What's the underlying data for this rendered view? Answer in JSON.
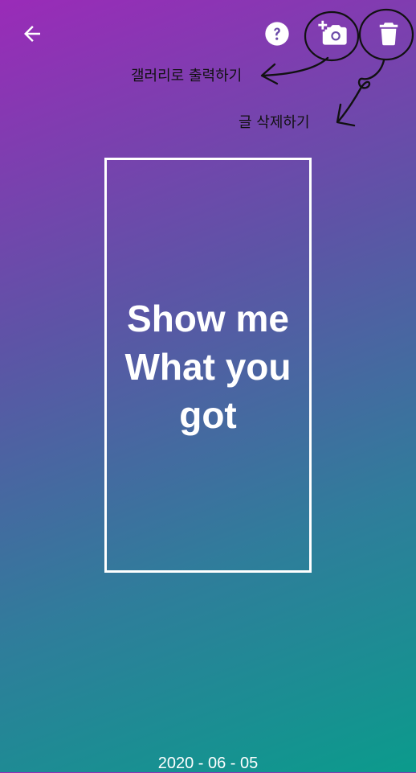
{
  "toolbar": {
    "back_icon": "arrow-left-icon",
    "help_icon": "question-circle-icon",
    "save_icon": "add-photo-camera-icon",
    "delete_icon": "trash-icon"
  },
  "annotations": {
    "save_to_gallery": "갤러리로 출력하기",
    "delete_post": "글 삭제하기"
  },
  "post": {
    "text": "Show me\nWhat you\ngot",
    "date": "2020 - 06 - 05"
  },
  "colors": {
    "gradient_top": "#9a2bb8",
    "gradient_bottom": "#0b9b8c",
    "foreground": "#ffffff",
    "annotation_ink": "#111111"
  }
}
